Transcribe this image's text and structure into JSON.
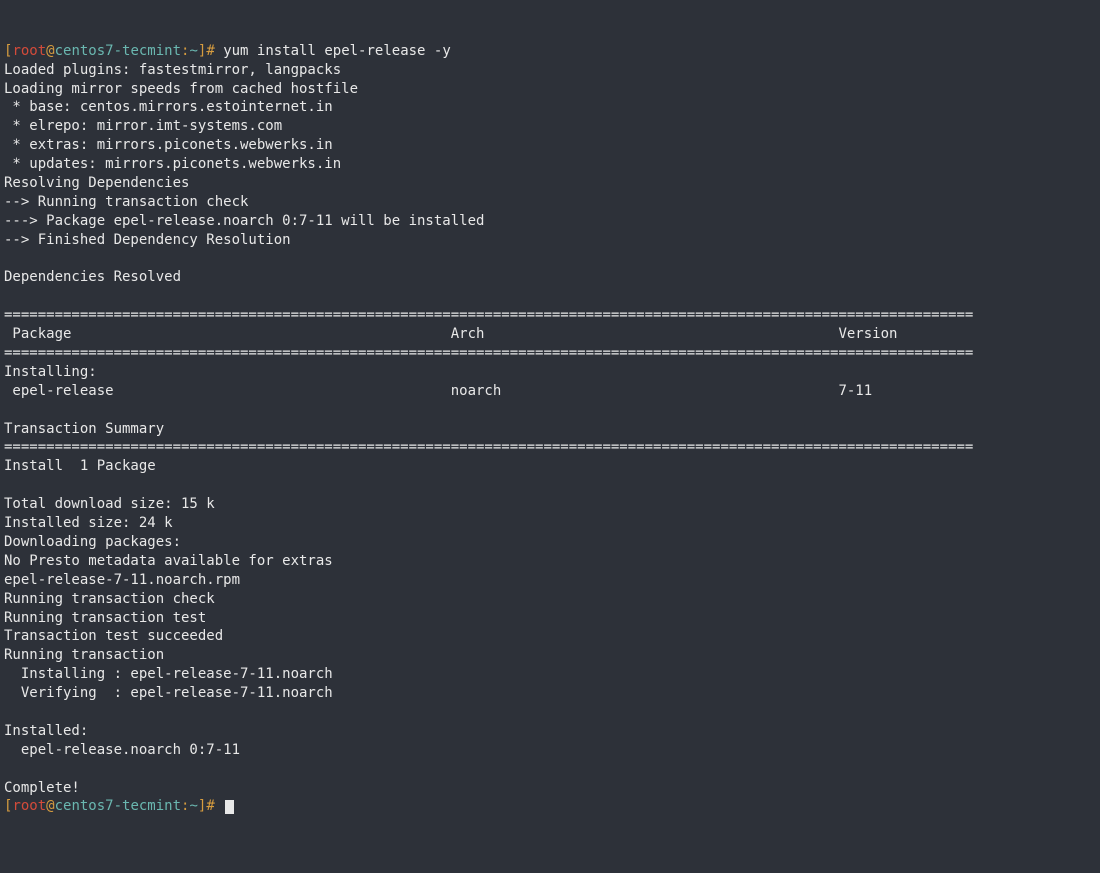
{
  "prompt1": {
    "lbracket": "[",
    "user": "root",
    "at": "@",
    "host": "centos7-tecmint",
    "colon": ":",
    "cwd": "~",
    "rbracket_hash": "]#",
    "command": " yum install epel-release -y"
  },
  "output": {
    "l1": "Loaded plugins: fastestmirror, langpacks",
    "l2": "Loading mirror speeds from cached hostfile",
    "l3": " * base: centos.mirrors.estointernet.in",
    "l4": " * elrepo: mirror.imt-systems.com",
    "l5": " * extras: mirrors.piconets.webwerks.in",
    "l6": " * updates: mirrors.piconets.webwerks.in",
    "l7": "Resolving Dependencies",
    "l8": "--> Running transaction check",
    "l9": "---> Package epel-release.noarch 0:7-11 will be installed",
    "l10": "--> Finished Dependency Resolution",
    "blank1": "",
    "l11": "Dependencies Resolved",
    "blank2": "",
    "sep1": "===================================================================================================================",
    "header": " Package                                             Arch                                          Version       ",
    "sep2": "===================================================================================================================",
    "l12": "Installing:",
    "l13": " epel-release                                        noarch                                        7-11          ",
    "blank3": "",
    "l14": "Transaction Summary",
    "sep3": "===================================================================================================================",
    "l15": "Install  1 Package",
    "blank4": "",
    "l16": "Total download size: 15 k",
    "l17": "Installed size: 24 k",
    "l18": "Downloading packages:",
    "l19": "No Presto metadata available for extras",
    "l20": "epel-release-7-11.noarch.rpm",
    "l21": "Running transaction check",
    "l22": "Running transaction test",
    "l23": "Transaction test succeeded",
    "l24": "Running transaction",
    "l25": "  Installing : epel-release-7-11.noarch",
    "l26": "  Verifying  : epel-release-7-11.noarch",
    "blank5": "",
    "l27": "Installed:",
    "l28": "  epel-release.noarch 0:7-11",
    "blank6": "",
    "l29": "Complete!"
  },
  "prompt2": {
    "lbracket": "[",
    "user": "root",
    "at": "@",
    "host": "centos7-tecmint",
    "colon": ":",
    "cwd": "~",
    "rbracket_hash": "]#",
    "command": " "
  }
}
